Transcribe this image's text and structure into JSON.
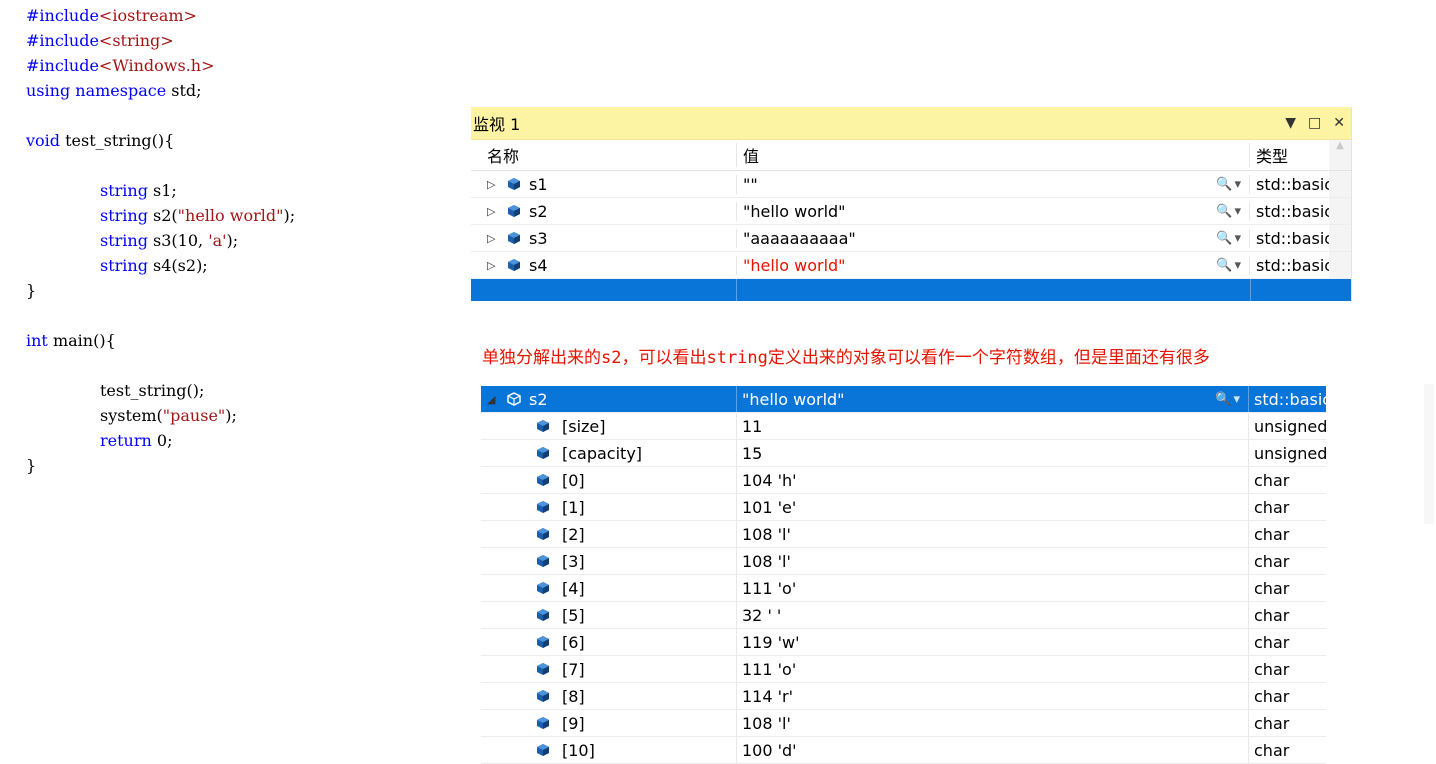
{
  "code": [
    {
      "parts": [
        {
          "t": "#include",
          "c": "pp"
        },
        {
          "t": "<iostream>",
          "c": "str"
        }
      ]
    },
    {
      "parts": [
        {
          "t": "#include",
          "c": "pp"
        },
        {
          "t": "<string>",
          "c": "str"
        }
      ]
    },
    {
      "parts": [
        {
          "t": "#include",
          "c": "pp"
        },
        {
          "t": "<Windows.h>",
          "c": "str"
        }
      ]
    },
    {
      "parts": [
        {
          "t": "using",
          "c": "kw"
        },
        {
          "t": " "
        },
        {
          "t": "namespace",
          "c": "kw"
        },
        {
          "t": " std;"
        }
      ]
    },
    {
      "parts": []
    },
    {
      "parts": [
        {
          "t": "void",
          "c": "kw"
        },
        {
          "t": " test_string(){"
        }
      ]
    },
    {
      "parts": []
    },
    {
      "indent": true,
      "parts": [
        {
          "t": "string",
          "c": "kw"
        },
        {
          "t": " s1;"
        }
      ]
    },
    {
      "indent": true,
      "parts": [
        {
          "t": "string",
          "c": "kw"
        },
        {
          "t": " s2("
        },
        {
          "t": "\"hello world\"",
          "c": "str"
        },
        {
          "t": ");"
        }
      ]
    },
    {
      "indent": true,
      "parts": [
        {
          "t": "string",
          "c": "kw"
        },
        {
          "t": " s3(10, "
        },
        {
          "t": "'a'",
          "c": "str"
        },
        {
          "t": ");"
        }
      ]
    },
    {
      "indent": true,
      "parts": [
        {
          "t": "string",
          "c": "kw"
        },
        {
          "t": " s4(s2);"
        }
      ]
    },
    {
      "parts": [
        {
          "t": "}"
        }
      ]
    },
    {
      "parts": []
    },
    {
      "parts": [
        {
          "t": "int",
          "c": "kw"
        },
        {
          "t": " main(){"
        }
      ]
    },
    {
      "parts": []
    },
    {
      "indent": true,
      "parts": [
        {
          "t": "test_string();"
        }
      ]
    },
    {
      "indent": true,
      "parts": [
        {
          "t": "system("
        },
        {
          "t": "\"pause\"",
          "c": "str"
        },
        {
          "t": ");"
        }
      ]
    },
    {
      "indent": true,
      "parts": [
        {
          "t": "return",
          "c": "kw"
        },
        {
          "t": " 0;"
        }
      ]
    },
    {
      "parts": [
        {
          "t": "}"
        }
      ]
    }
  ],
  "watch": {
    "title": "监视 1",
    "headers": {
      "name": "名称",
      "value": "值",
      "type": "类型"
    },
    "rows": [
      {
        "name": "s1",
        "value": "\"\"",
        "type": "std::basic_string",
        "changed": false
      },
      {
        "name": "s2",
        "value": "\"hello world\"",
        "type": "std::basic_string",
        "changed": false
      },
      {
        "name": "s3",
        "value": "\"aaaaaaaaaa\"",
        "type": "std::basic_string",
        "changed": false
      },
      {
        "name": "s4",
        "value": "\"hello world\"",
        "type": "std::basic_string",
        "changed": true
      }
    ]
  },
  "note": "单独分解出来的s2，可以看出string定义出来的对象可以看作一个字符数组，但是里面还有很多",
  "expanded": {
    "name": "s2",
    "value": "\"hello world\"",
    "type": "std::basic_string",
    "children": [
      {
        "name": "[size]",
        "value": "11",
        "type": "unsigned int"
      },
      {
        "name": "[capacity]",
        "value": "15",
        "type": "unsigned int"
      },
      {
        "name": "[0]",
        "value": "104 'h'",
        "type": "char"
      },
      {
        "name": "[1]",
        "value": "101 'e'",
        "type": "char"
      },
      {
        "name": "[2]",
        "value": "108 'l'",
        "type": "char"
      },
      {
        "name": "[3]",
        "value": "108 'l'",
        "type": "char"
      },
      {
        "name": "[4]",
        "value": "111 'o'",
        "type": "char"
      },
      {
        "name": "[5]",
        "value": "32 ' '",
        "type": "char"
      },
      {
        "name": "[6]",
        "value": "119 'w'",
        "type": "char"
      },
      {
        "name": "[7]",
        "value": "111 'o'",
        "type": "char"
      },
      {
        "name": "[8]",
        "value": "114 'r'",
        "type": "char"
      },
      {
        "name": "[9]",
        "value": "108 'l'",
        "type": "char"
      },
      {
        "name": "[10]",
        "value": "100 'd'",
        "type": "char"
      }
    ]
  },
  "colors": {
    "accent": "#0a75d8",
    "changed": "#e51400",
    "titlebar": "#fcf3a3",
    "keyword": "#0000ff",
    "string": "#a31515"
  }
}
